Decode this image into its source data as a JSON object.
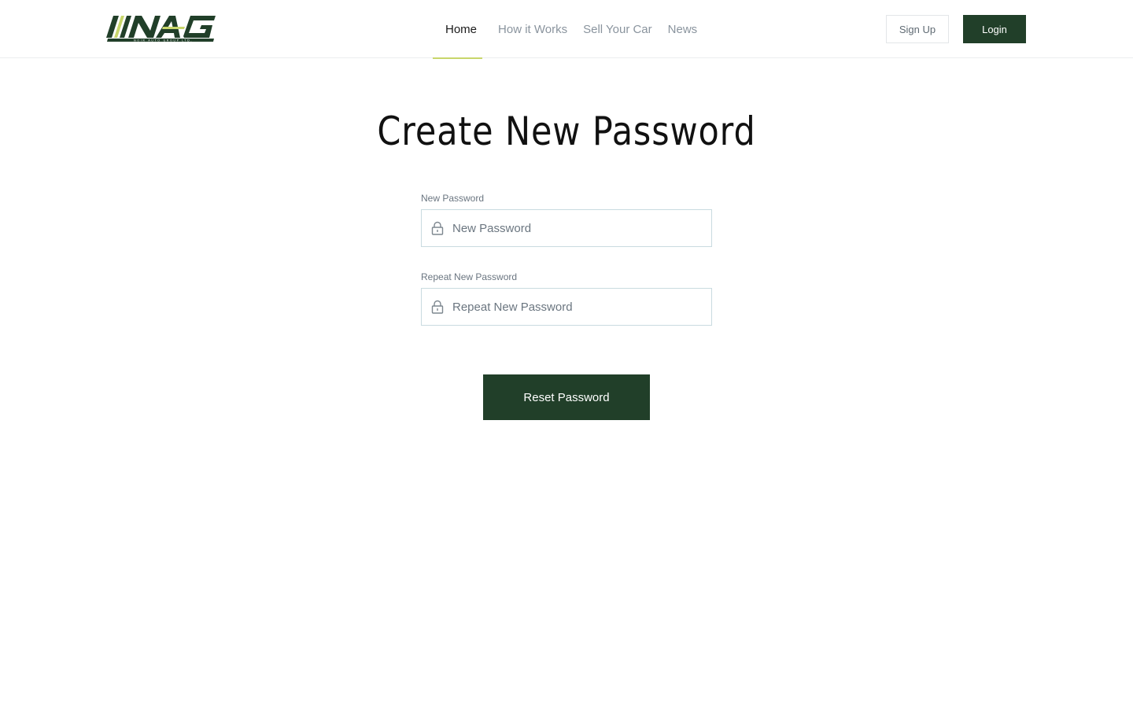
{
  "header": {
    "logo": {
      "text": "NAG",
      "subtext": "NOIR AUTO GROUP LTD.",
      "icon": "nag-logo-icon",
      "colors": {
        "dark": "#213f29",
        "accent": "#c8d66b"
      }
    },
    "nav": [
      {
        "label": "Home",
        "active": true
      },
      {
        "label": "How it Works",
        "active": false
      },
      {
        "label": "Sell Your Car",
        "active": false
      },
      {
        "label": "News",
        "active": false
      }
    ],
    "signup_label": "Sign Up",
    "login_label": "Login"
  },
  "main": {
    "title": "Create New Password",
    "fields": [
      {
        "label": "New Password",
        "placeholder": "New Password",
        "value": "",
        "icon": "lock-icon"
      },
      {
        "label": "Repeat New Password",
        "placeholder": "Repeat New Password",
        "value": "",
        "icon": "lock-icon"
      }
    ],
    "submit_label": "Reset Password"
  },
  "colors": {
    "brand": "#213f29",
    "accent": "#c8d66b",
    "nav_inactive": "#8a949e",
    "input_border": "#c9dbe0"
  }
}
